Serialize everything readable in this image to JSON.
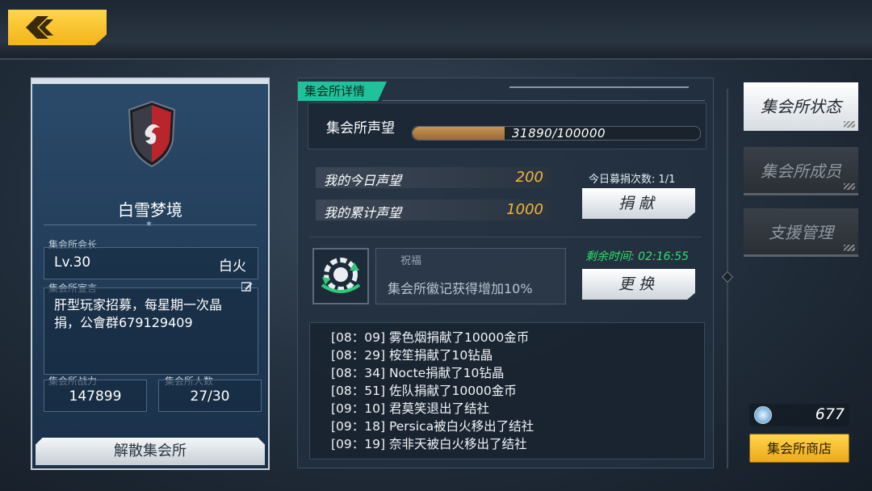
{
  "colors": {
    "accent_yellow": "#f2b41b",
    "accent_green": "#1fc29a",
    "timer_green": "#2ee06a",
    "value_gold": "#f2b63a"
  },
  "header": {
    "back_icon": "chevron-left-icon"
  },
  "guild": {
    "name": "白雪梦境",
    "leader_label": "集会所会长",
    "leader_level": "Lv.30",
    "leader_name": "白火",
    "declaration_label": "集会所宣言",
    "declaration": "肝型玩家招募，每星期一次晶捐，公會群679129409",
    "power_label": "集会所战力",
    "power": "147899",
    "members_label": "集会所人数",
    "members": "27/30",
    "disband_label": "解散集会所"
  },
  "details": {
    "tag": "集会所详情",
    "reputation_label": "集会所声望",
    "reputation_text": "31890/100000",
    "reputation_progress": 0.3189,
    "today_label": "我的今日声望",
    "today_value": "200",
    "total_label": "我的累计声望",
    "total_value": "1000",
    "donate_count": "今日募捐次数: 1/1",
    "donate_button": "捐献",
    "blessing_title": "祝福",
    "blessing_desc": "集会所徽记获得增加10%",
    "remaining": "剩余时间: 02:16:55",
    "change_button": "更换",
    "log": [
      "[08：09] 雾色烟捐献了10000金币",
      "[08：29] 桉笙捐献了10钻晶",
      "[08：34] Nocte捐献了10钻晶",
      "[08：51] 佐队捐献了10000金币",
      "[09：10] 君莫笑退出了结社",
      "[09：18] Persica被白火移出了结社",
      "[09：19] 奈非天被白火移出了结社"
    ]
  },
  "tabs": [
    "集会所状态",
    "集会所成员",
    "支援管理"
  ],
  "currency": {
    "icon": "crystal-coin-icon",
    "value": "677"
  },
  "shop_label": "集会所商店"
}
